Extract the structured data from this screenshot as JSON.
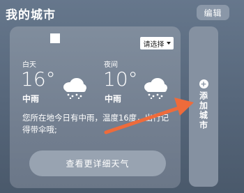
{
  "header": {
    "title": "我的城市",
    "edit_label": "编辑"
  },
  "card": {
    "select_label": "请选择",
    "day": {
      "label": "白天",
      "temperature": "16°",
      "condition": "中雨",
      "icon": "rain-cloud-icon"
    },
    "night": {
      "label": "夜间",
      "temperature": "10°",
      "condition": "中雨",
      "icon": "rain-cloud-icon"
    },
    "tip": "您所在地今日有中雨，温度16度，出行记得带伞哦;",
    "detail_button_label": "查看更详细天气"
  },
  "add_city": {
    "icon": "plus-circle-icon",
    "label": "添加城市"
  },
  "colors": {
    "annotation_arrow": "#ee6b3b",
    "card_bg": "#7a8797",
    "page_bg": "#5d6d82"
  }
}
